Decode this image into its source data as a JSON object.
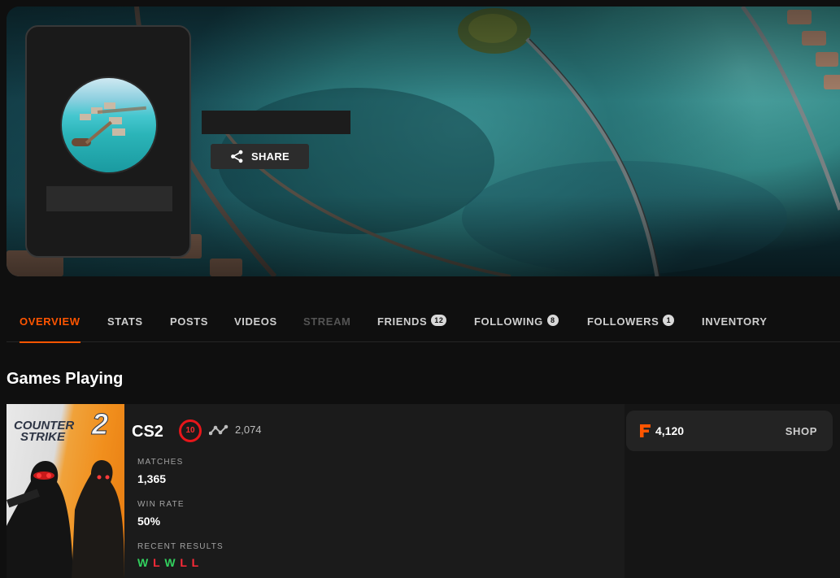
{
  "profile": {
    "share_label": "SHARE"
  },
  "tabs": [
    {
      "label": "OVERVIEW",
      "active": true
    },
    {
      "label": "STATS"
    },
    {
      "label": "POSTS"
    },
    {
      "label": "VIDEOS"
    },
    {
      "label": "STREAM",
      "disabled": true
    },
    {
      "label": "FRIENDS",
      "count": "12"
    },
    {
      "label": "FOLLOWING",
      "count": "8"
    },
    {
      "label": "FOLLOWERS",
      "count": "1"
    },
    {
      "label": "INVENTORY"
    }
  ],
  "games_section": {
    "title": "Games Playing",
    "game": {
      "cover_title_line1": "COUNTER",
      "cover_title_line2": "STRIKE",
      "cover_title_number": "2",
      "name": "CS2",
      "skill_level": "10",
      "elo": "2,074",
      "matches_label": "MATCHES",
      "matches_value": "1,365",
      "win_rate_label": "WIN RATE",
      "win_rate_value": "50%",
      "recent_results_label": "RECENT RESULTS",
      "recent_results": [
        "W",
        "L",
        "W",
        "L",
        "L"
      ]
    },
    "points": {
      "value": "4,120",
      "shop_label": "SHOP"
    }
  },
  "colors": {
    "accent": "#ff5500",
    "win": "#32d25f",
    "loss": "#ff2a38",
    "level_10": "#e8161a"
  }
}
